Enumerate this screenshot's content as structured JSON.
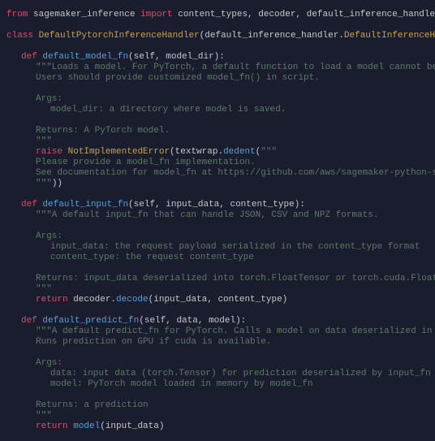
{
  "code": {
    "lines": [
      {
        "cls": "",
        "spans": [
          [
            "kw",
            "from"
          ],
          [
            "sym",
            " sagemaker_inference "
          ],
          [
            "kw",
            "import"
          ],
          [
            "sym",
            " content_types, decoder, default_inference_handler, encoder, errors"
          ]
        ]
      },
      {
        "cls": "",
        "spans": []
      },
      {
        "cls": "",
        "spans": [
          [
            "kw",
            "class"
          ],
          [
            "sym",
            " "
          ],
          [
            "cls",
            "DefaultPytorchInferenceHandler"
          ],
          [
            "pun",
            "(default_inference_handler."
          ],
          [
            "cls",
            "DefaultInferenceHandler"
          ],
          [
            "pun",
            "):"
          ]
        ]
      },
      {
        "cls": "",
        "spans": []
      },
      {
        "cls": "ind1",
        "spans": [
          [
            "kw",
            "def"
          ],
          [
            "sym",
            " "
          ],
          [
            "func",
            "default_model_fn"
          ],
          [
            "pun",
            "(self, model_dir):"
          ]
        ]
      },
      {
        "cls": "ind2",
        "spans": [
          [
            "str",
            "\"\"\"Loads a model. For PyTorch, a default function to load a model cannot be provided."
          ]
        ]
      },
      {
        "cls": "ind2",
        "spans": [
          [
            "str",
            "Users should provide customized model_fn() in script."
          ]
        ]
      },
      {
        "cls": "",
        "spans": []
      },
      {
        "cls": "ind2",
        "spans": [
          [
            "str",
            "Args:"
          ]
        ]
      },
      {
        "cls": "ind3",
        "spans": [
          [
            "str",
            "model_dir: a directory where model is saved."
          ]
        ]
      },
      {
        "cls": "",
        "spans": []
      },
      {
        "cls": "ind2",
        "spans": [
          [
            "str",
            "Returns: A PyTorch model."
          ]
        ]
      },
      {
        "cls": "ind2",
        "spans": [
          [
            "str",
            "\"\"\""
          ]
        ]
      },
      {
        "cls": "ind2",
        "spans": [
          [
            "kw",
            "raise"
          ],
          [
            "sym",
            " "
          ],
          [
            "cls",
            "NotImplementedError"
          ],
          [
            "pun",
            "(textwrap."
          ],
          [
            "func",
            "dedent"
          ],
          [
            "pun",
            "("
          ],
          [
            "str",
            "\"\"\""
          ]
        ]
      },
      {
        "cls": "ind2",
        "spans": [
          [
            "str",
            "Please provide a model_fn implementation."
          ]
        ]
      },
      {
        "cls": "ind2",
        "spans": [
          [
            "str",
            "See documentation for model_fn at https://github.com/aws/sagemaker-python-sdk"
          ]
        ]
      },
      {
        "cls": "ind2",
        "spans": [
          [
            "str",
            "\"\"\""
          ],
          [
            "pun",
            "))"
          ]
        ]
      },
      {
        "cls": "",
        "spans": []
      },
      {
        "cls": "ind1",
        "spans": [
          [
            "kw",
            "def"
          ],
          [
            "sym",
            " "
          ],
          [
            "func",
            "default_input_fn"
          ],
          [
            "pun",
            "(self, input_data, content_type):"
          ]
        ]
      },
      {
        "cls": "ind2",
        "spans": [
          [
            "str",
            "\"\"\"A default input_fn that can handle JSON, CSV and NPZ formats."
          ]
        ]
      },
      {
        "cls": "",
        "spans": []
      },
      {
        "cls": "ind2",
        "spans": [
          [
            "str",
            "Args:"
          ]
        ]
      },
      {
        "cls": "ind3",
        "spans": [
          [
            "str",
            "input_data: the request payload serialized in the content_type format"
          ]
        ]
      },
      {
        "cls": "ind3",
        "spans": [
          [
            "str",
            "content_type: the request content_type"
          ]
        ]
      },
      {
        "cls": "",
        "spans": []
      },
      {
        "cls": "ind2",
        "spans": [
          [
            "str",
            "Returns: input_data deserialized into torch.FloatTensor or torch.cuda.FloatTensor depending if cu"
          ]
        ]
      },
      {
        "cls": "ind2",
        "spans": [
          [
            "str",
            "\"\"\""
          ]
        ]
      },
      {
        "cls": "ind2",
        "spans": [
          [
            "kw",
            "return"
          ],
          [
            "sym",
            " decoder."
          ],
          [
            "func",
            "decode"
          ],
          [
            "pun",
            "(input_data, content_type)"
          ]
        ]
      },
      {
        "cls": "",
        "spans": []
      },
      {
        "cls": "ind1",
        "spans": [
          [
            "kw",
            "def"
          ],
          [
            "sym",
            " "
          ],
          [
            "func",
            "default_predict_fn"
          ],
          [
            "pun",
            "(self, data, model):"
          ]
        ]
      },
      {
        "cls": "ind2",
        "spans": [
          [
            "str",
            "\"\"\"A default predict_fn for PyTorch. Calls a model on data deserialized in input_fn."
          ]
        ]
      },
      {
        "cls": "ind2",
        "spans": [
          [
            "str",
            "Runs prediction on GPU if cuda is available."
          ]
        ]
      },
      {
        "cls": "",
        "spans": []
      },
      {
        "cls": "ind2",
        "spans": [
          [
            "str",
            "Args:"
          ]
        ]
      },
      {
        "cls": "ind3",
        "spans": [
          [
            "str",
            "data: input data (torch.Tensor) for prediction deserialized by input_fn"
          ]
        ]
      },
      {
        "cls": "ind3",
        "spans": [
          [
            "str",
            "model: PyTorch model loaded in memory by model_fn"
          ]
        ]
      },
      {
        "cls": "",
        "spans": []
      },
      {
        "cls": "ind2",
        "spans": [
          [
            "str",
            "Returns: a prediction"
          ]
        ]
      },
      {
        "cls": "ind2",
        "spans": [
          [
            "str",
            "\"\"\""
          ]
        ]
      },
      {
        "cls": "ind2",
        "spans": [
          [
            "kw",
            "return"
          ],
          [
            "sym",
            " "
          ],
          [
            "func",
            "model"
          ],
          [
            "pun",
            "(input_data)"
          ]
        ]
      }
    ]
  }
}
